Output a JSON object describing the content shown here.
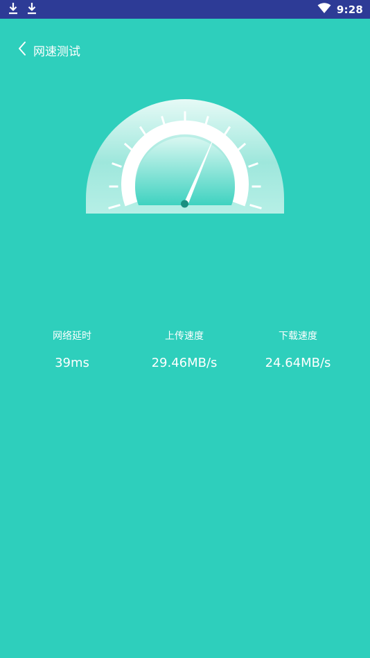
{
  "status_bar": {
    "time": "9:28",
    "left_icons": [
      "download-icon",
      "download-icon"
    ],
    "right_icons": [
      "wifi-icon"
    ]
  },
  "header": {
    "back_icon": "chevron-left-icon",
    "title": "网速测试"
  },
  "gauge": {
    "needle_fraction": 0.7
  },
  "stats": {
    "latency_label": "网络延时",
    "latency_value": "39ms",
    "upload_label": "上传速度",
    "upload_value": "29.46MB/s",
    "download_label": "下载速度",
    "download_value": "24.64MB/s"
  },
  "colors": {
    "background": "#2ecfbc",
    "status_bar": "#2d3b96",
    "needle_hub": "#1a8f80"
  }
}
